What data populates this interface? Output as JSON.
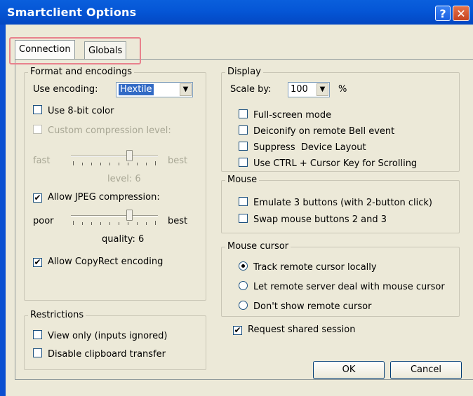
{
  "window": {
    "title": "Smartclient Options",
    "help_label": "?",
    "close_label": "✕"
  },
  "tabs": [
    {
      "label": "Connection",
      "active": true
    },
    {
      "label": "Globals",
      "active": false
    }
  ],
  "format": {
    "legend": "Format and encodings",
    "encoding_label": "Use encoding:",
    "encoding_value": "Hextile",
    "use_8bit_color": "Use 8-bit color",
    "use_8bit_checked": false,
    "custom_compression": "Custom compression level:",
    "custom_compression_checked": false,
    "fast_label": "fast",
    "best_label": "best",
    "level_text": "level: 6",
    "allow_jpeg": "Allow JPEG compression:",
    "allow_jpeg_checked": true,
    "poor_label": "poor",
    "best_label_2": "best",
    "quality_text": "quality: 6",
    "allow_copyrect": "Allow CopyRect encoding",
    "allow_copyrect_checked": true,
    "compression_level": 6,
    "jpeg_quality": 6
  },
  "restrictions": {
    "legend": "Restrictions",
    "view_only": "View only (inputs ignored)",
    "view_only_checked": false,
    "disable_clipboard": "Disable clipboard transfer",
    "disable_clipboard_checked": false
  },
  "display": {
    "legend": "Display",
    "scale_label": "Scale by:",
    "scale_value": "100",
    "percent": "%",
    "fullscreen": "Full-screen mode",
    "deiconify": "Deiconify on remote Bell event",
    "suppress": "Suppress  Device Layout",
    "ctrl_cursor": "Use CTRL + Cursor Key for Scrolling"
  },
  "mouse": {
    "legend": "Mouse",
    "emulate": "Emulate 3 buttons (with 2-button click)",
    "swap": "Swap mouse buttons 2 and 3"
  },
  "cursor": {
    "legend": "Mouse cursor",
    "track": "Track remote cursor locally",
    "let_remote": "Let remote server deal with mouse cursor",
    "dont_show": "Don't show remote cursor",
    "selected": "track"
  },
  "shared": {
    "label": "Request shared session",
    "checked": true
  },
  "buttons": {
    "ok": "OK",
    "cancel": "Cancel"
  }
}
